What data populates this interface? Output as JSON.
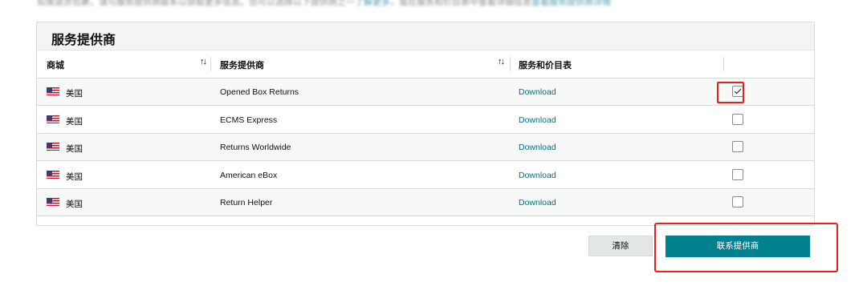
{
  "top_text": {
    "before": "如需退货包裹，请与服务提供商联系以获取更多信息。您可以选择以下提供商之一",
    "link1": "了解更多",
    "middle": "，或在服务和价目表中查看详细信息",
    "link2": "查看服务提供商详情"
  },
  "panel": {
    "title": "服务提供商",
    "columns": {
      "marketplace": "商城",
      "provider": "服务提供商",
      "rates": "服务和价目表"
    },
    "sort_icon": "↑↓",
    "rows": [
      {
        "marketplace": "美国",
        "provider": "Opened Box Returns",
        "rates": "Download",
        "selected": true
      },
      {
        "marketplace": "美国",
        "provider": "ECMS Express",
        "rates": "Download",
        "selected": false
      },
      {
        "marketplace": "美国",
        "provider": "Returns Worldwide",
        "rates": "Download",
        "selected": false
      },
      {
        "marketplace": "美国",
        "provider": "American eBox",
        "rates": "Download",
        "selected": false
      },
      {
        "marketplace": "美国",
        "provider": "Return Helper",
        "rates": "Download",
        "selected": false
      }
    ]
  },
  "buttons": {
    "clear": "清除",
    "contact": "联系提供商"
  },
  "colors": {
    "accent": "#00818d",
    "link": "#007185",
    "highlight_red": "#e8201b"
  }
}
